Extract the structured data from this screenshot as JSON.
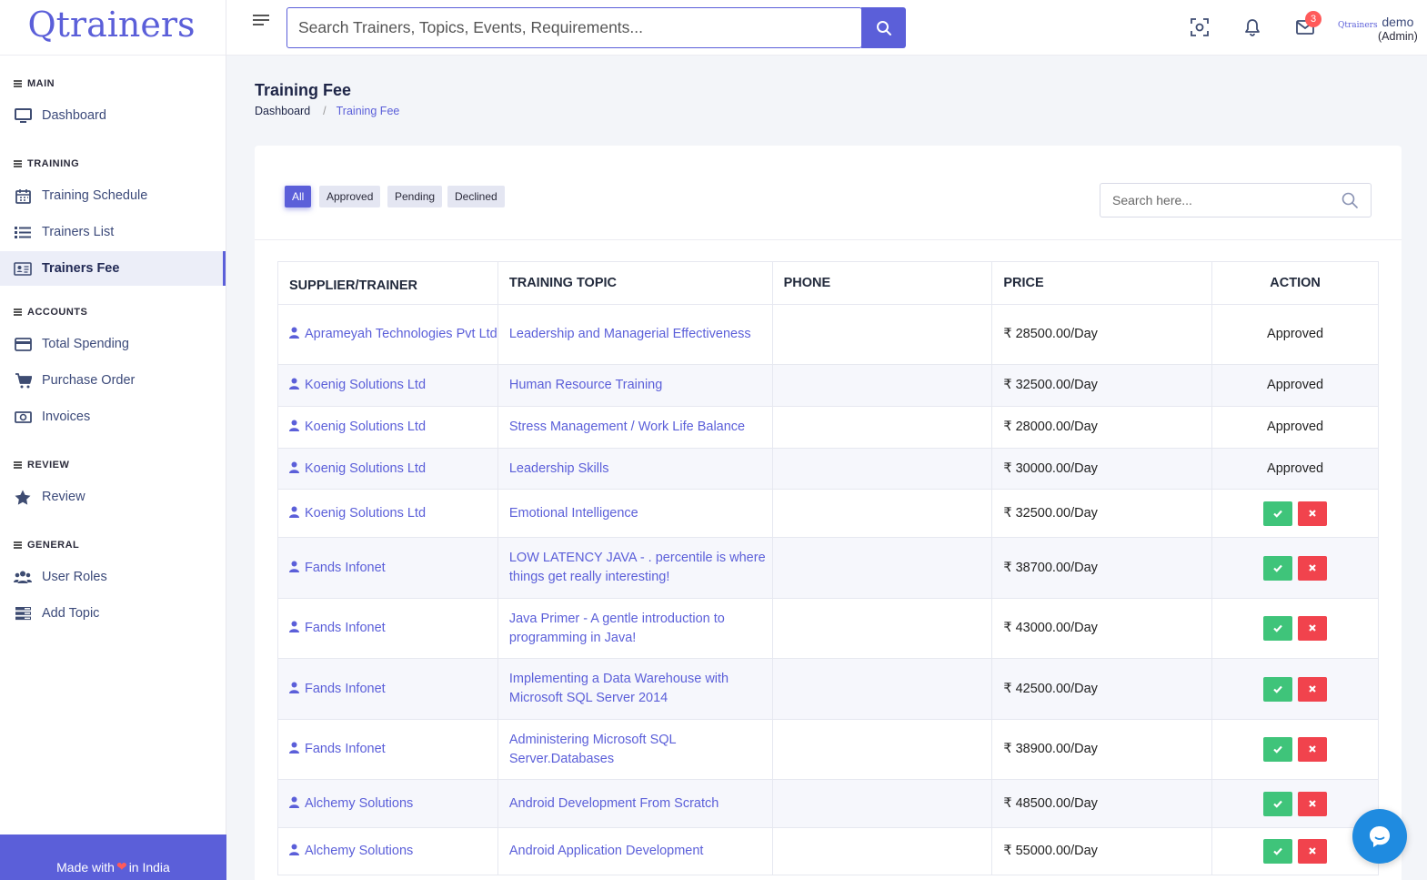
{
  "app": {
    "logo": "Qtrainers",
    "brand_small": "Qtrainers",
    "footer_made": "Made with",
    "footer_in": "in India",
    "accent": "#5b5fd9"
  },
  "topbar": {
    "search_placeholder": "Search Trainers, Topics, Events, Requirements...",
    "notification_count": "3",
    "user_name": "demo",
    "user_role": "(Admin)"
  },
  "sidebar": {
    "sections": [
      {
        "title": "MAIN",
        "items": [
          {
            "label": "Dashboard",
            "icon": "monitor-icon"
          }
        ]
      },
      {
        "title": "TRAINING",
        "items": [
          {
            "label": "Training Schedule",
            "icon": "calendar-icon"
          },
          {
            "label": "Trainers List",
            "icon": "list-icon"
          },
          {
            "label": "Trainers Fee",
            "icon": "id-card-icon",
            "active": true
          }
        ]
      },
      {
        "title": "ACCOUNTS",
        "items": [
          {
            "label": "Total Spending",
            "icon": "credit-card-icon"
          },
          {
            "label": "Purchase Order",
            "icon": "cart-icon"
          },
          {
            "label": "Invoices",
            "icon": "money-icon"
          }
        ]
      },
      {
        "title": "REVIEW",
        "items": [
          {
            "label": "Review",
            "icon": "star-icon"
          }
        ]
      },
      {
        "title": "GENERAL",
        "items": [
          {
            "label": "User Roles",
            "icon": "users-icon"
          },
          {
            "label": "Add Topic",
            "icon": "stack-icon"
          }
        ]
      }
    ]
  },
  "page": {
    "title": "Training Fee",
    "breadcrumb": [
      "Dashboard",
      "Training Fee"
    ]
  },
  "filters": [
    "All",
    "Approved",
    "Pending",
    "Declined"
  ],
  "table_search_placeholder": "Search here...",
  "table": {
    "headers": [
      "SUPPLIER/TRAINER",
      "TRAINING TOPIC",
      "PHONE",
      "PRICE",
      "ACTION"
    ],
    "rows": [
      {
        "supplier": "Aprameyah Technologies Pvt Ltd",
        "topic": "Leadership and Managerial Effectiveness",
        "phone": "",
        "price": "₹ 28500.00/Day",
        "status": "Approved"
      },
      {
        "supplier": "Koenig Solutions Ltd",
        "topic": "Human Resource Training",
        "phone": "",
        "price": "₹ 32500.00/Day",
        "status": "Approved"
      },
      {
        "supplier": "Koenig Solutions Ltd",
        "topic": "Stress Management / Work Life Balance",
        "phone": "",
        "price": "₹ 28000.00/Day",
        "status": "Approved"
      },
      {
        "supplier": "Koenig Solutions Ltd",
        "topic": "Leadership Skills",
        "phone": "",
        "price": "₹ 30000.00/Day",
        "status": "Approved"
      },
      {
        "supplier": "Koenig Solutions Ltd",
        "topic": "Emotional Intelligence",
        "phone": "",
        "price": "₹ 32500.00/Day",
        "status": ""
      },
      {
        "supplier": "Fands Infonet",
        "topic": "LOW LATENCY JAVA - . percentile is where things get really interesting!",
        "phone": "",
        "price": "₹ 38700.00/Day",
        "status": ""
      },
      {
        "supplier": "Fands Infonet",
        "topic": "Java Primer - A gentle introduction to programming in Java!",
        "phone": "",
        "price": "₹ 43000.00/Day",
        "status": ""
      },
      {
        "supplier": "Fands Infonet",
        "topic": "Implementing a Data Warehouse with Microsoft SQL Server 2014",
        "phone": "",
        "price": "₹ 42500.00/Day",
        "status": ""
      },
      {
        "supplier": "Fands Infonet",
        "topic": "Administering Microsoft SQL Server.Databases",
        "phone": "",
        "price": "₹ 38900.00/Day",
        "status": ""
      },
      {
        "supplier": "Alchemy Solutions",
        "topic": "Android Development From Scratch",
        "phone": "",
        "price": "₹ 48500.00/Day",
        "status": ""
      },
      {
        "supplier": "Alchemy Solutions",
        "topic": "Android Application Development",
        "phone": "",
        "price": "₹ 55000.00/Day",
        "status": ""
      }
    ]
  }
}
